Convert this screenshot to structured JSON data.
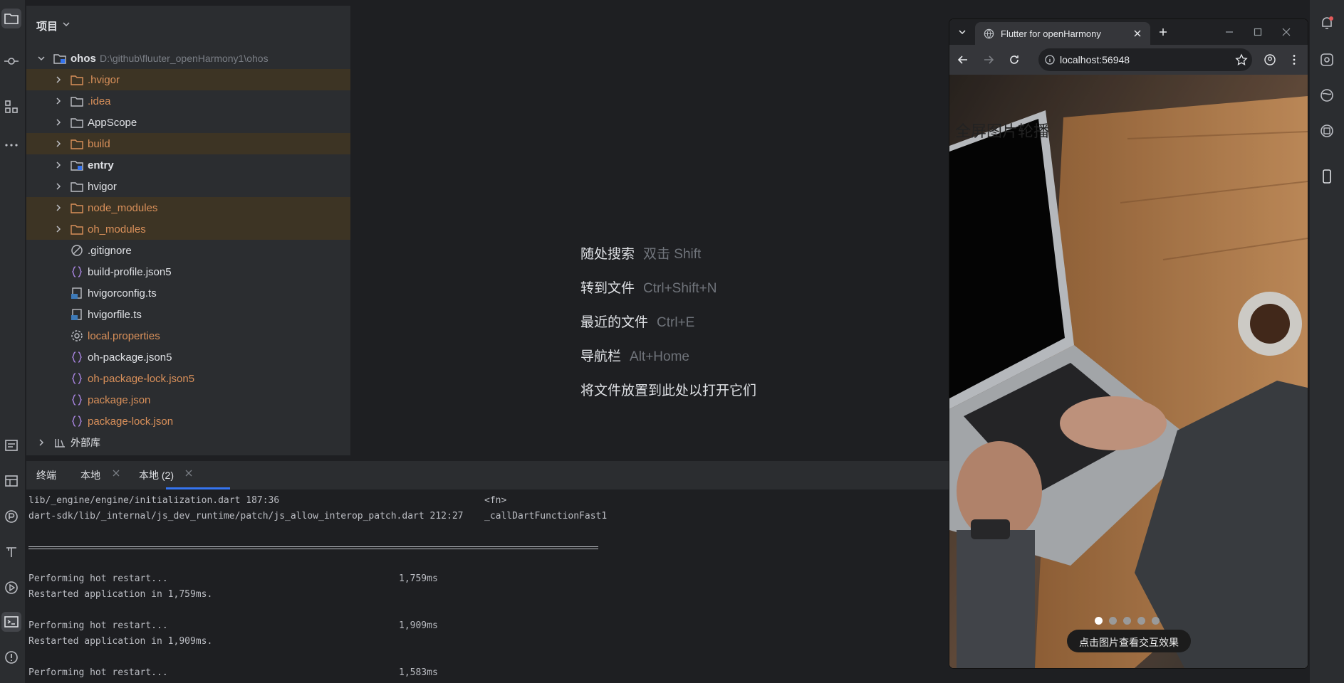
{
  "project_panel": {
    "title": "项目",
    "items": [
      {
        "label": "ohos",
        "suffix": "D:\\github\\fluuter_openHarmony1\\ohos"
      },
      {
        "label": ".hvigor"
      },
      {
        "label": ".idea"
      },
      {
        "label": "AppScope"
      },
      {
        "label": "build"
      },
      {
        "label": "entry"
      },
      {
        "label": "hvigor"
      },
      {
        "label": "node_modules"
      },
      {
        "label": "oh_modules"
      },
      {
        "label": ".gitignore"
      },
      {
        "label": "build-profile.json5"
      },
      {
        "label": "hvigorconfig.ts"
      },
      {
        "label": "hvigorfile.ts"
      },
      {
        "label": "local.properties"
      },
      {
        "label": "oh-package.json5"
      },
      {
        "label": "oh-package-lock.json5"
      },
      {
        "label": "package.json"
      },
      {
        "label": "package-lock.json"
      },
      {
        "label": "外部库"
      }
    ]
  },
  "editor": {
    "hints": [
      {
        "action": "随处搜索",
        "shortcut": "双击 Shift"
      },
      {
        "action": "转到文件",
        "shortcut": "Ctrl+Shift+N"
      },
      {
        "action": "最近的文件",
        "shortcut": "Ctrl+E"
      },
      {
        "action": "导航栏",
        "shortcut": "Alt+Home"
      },
      {
        "action": "将文件放置到此处以打开它们",
        "shortcut": ""
      }
    ]
  },
  "terminal": {
    "tabs": [
      "终端",
      "本地",
      "本地 (2)"
    ],
    "lines": [
      {
        "text": "lib/_engine/engine/initialization.dart 187:36",
        "right": "<fn>"
      },
      {
        "text": "dart-sdk/lib/_internal/js_dev_runtime/patch/js_allow_interop_patch.dart 212:27",
        "right": "_callDartFunctionFast1"
      },
      {
        "text": "Performing hot restart...",
        "time": "1,759ms"
      },
      {
        "text": "Restarted application in 1,759ms."
      },
      {
        "text": "Performing hot restart...",
        "time": "1,909ms"
      },
      {
        "text": "Restarted application in 1,909ms."
      },
      {
        "text": "Performing hot restart...",
        "time": "1,583ms"
      }
    ]
  },
  "browser": {
    "tab_title": "Flutter for openHarmony",
    "url": "localhost:56948",
    "carousel": {
      "title": "全屏图片轮播",
      "dots": 5,
      "active_dot": 0,
      "caption": "点击图片查看交互效果"
    }
  }
}
